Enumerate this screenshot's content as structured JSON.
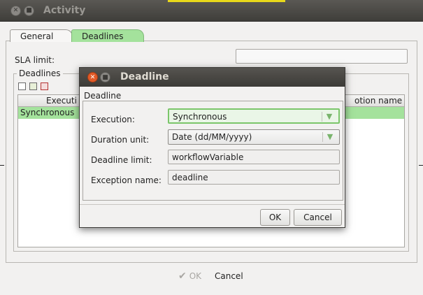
{
  "window": {
    "title": "Activity",
    "tabs": [
      {
        "label": "General"
      },
      {
        "label": "Deadlines"
      }
    ],
    "sla_label": "SLA limit:",
    "sla_value": "",
    "deadlines_group_label": "Deadlines",
    "table": {
      "col_execution": "Executi",
      "col_exception": "otion name",
      "row_execution": "Synchronous"
    },
    "ok_label": "OK",
    "cancel_label": "Cancel"
  },
  "dialog": {
    "title": "Deadline",
    "group_label": "Deadline",
    "fields": {
      "execution": {
        "label": "Execution:",
        "value": "Synchronous"
      },
      "duration_unit": {
        "label": "Duration unit:",
        "value": "Date (dd/MM/yyyy)"
      },
      "deadline_limit": {
        "label": "Deadline limit:",
        "value": "workflowVariable"
      },
      "exception_name": {
        "label": "Exception name:",
        "value": "deadline"
      }
    },
    "ok_label": "OK",
    "cancel_label": "Cancel"
  },
  "colors": {
    "accent_green": "#a4e29c",
    "close_orange": "#e25a27",
    "titlebar_dark": "#3f3e3a"
  },
  "icons": [
    "close-icon",
    "minimize-icon",
    "add-deadline-icon",
    "edit-deadline-icon",
    "delete-deadline-icon",
    "check-icon",
    "chevron-down-icon"
  ]
}
